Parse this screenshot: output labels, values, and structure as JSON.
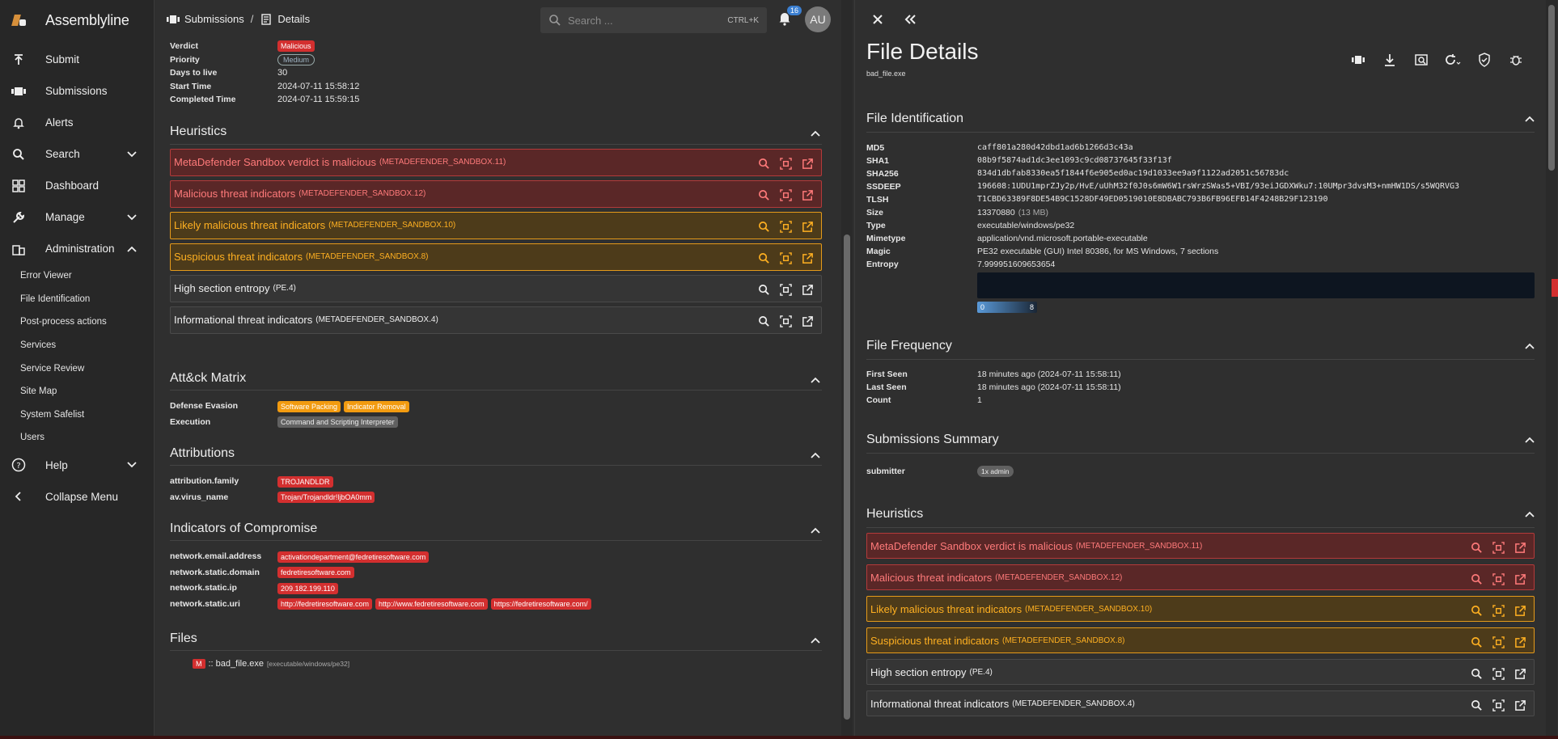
{
  "app": {
    "title": "Assemblyline"
  },
  "sidebar": {
    "items": [
      {
        "label": "Submit",
        "icon": "upload-icon"
      },
      {
        "label": "Submissions",
        "icon": "film-icon"
      },
      {
        "label": "Alerts",
        "icon": "bell-icon"
      },
      {
        "label": "Search",
        "icon": "search-icon"
      },
      {
        "label": "Dashboard",
        "icon": "dashboard-icon"
      },
      {
        "label": "Manage",
        "icon": "wrench-icon"
      },
      {
        "label": "Administration",
        "icon": "building-icon"
      }
    ],
    "admin_items": [
      "Error Viewer",
      "File Identification",
      "Post-process actions",
      "Services",
      "Service Review",
      "Site Map",
      "System Safelist",
      "Users"
    ],
    "help": "Help",
    "collapse": "Collapse Menu"
  },
  "topbar": {
    "crumb1": "Submissions",
    "crumb2": "Details",
    "search_placeholder": "Search ...",
    "shortcut": "CTRL+K",
    "notif_count": "16",
    "avatar": "AU"
  },
  "summary": {
    "verdict_label": "Verdict",
    "verdict": "Malicious",
    "priority_label": "Priority",
    "priority": "Medium",
    "ttl_label": "Days to live",
    "ttl": "30",
    "start_label": "Start Time",
    "start": "2024-07-11 15:58:12",
    "completed_label": "Completed Time",
    "completed": "2024-07-11 15:59:15"
  },
  "sections": {
    "heuristics": "Heuristics",
    "attack": "Att&ck Matrix",
    "attributions": "Attributions",
    "ioc": "Indicators of Compromise",
    "files": "Files"
  },
  "heuristics": [
    {
      "name": "MetaDefender Sandbox verdict is malicious",
      "id": "(METADEFENDER_SANDBOX.11)",
      "level": "mal"
    },
    {
      "name": "Malicious threat indicators",
      "id": "(METADEFENDER_SANDBOX.12)",
      "level": "mal"
    },
    {
      "name": "Likely malicious threat indicators",
      "id": "(METADEFENDER_SANDBOX.10)",
      "level": "sus"
    },
    {
      "name": "Suspicious threat indicators",
      "id": "(METADEFENDER_SANDBOX.8)",
      "level": "sus"
    },
    {
      "name": "High section entropy",
      "id": "(PE.4)",
      "level": "inf"
    },
    {
      "name": "Informational threat indicators",
      "id": "(METADEFENDER_SANDBOX.4)",
      "level": "inf"
    }
  ],
  "attack": {
    "defense_label": "Defense Evasion",
    "defense": [
      "Software Packing",
      "Indicator Removal"
    ],
    "exec_label": "Execution",
    "exec": [
      "Command and Scripting Interpreter"
    ]
  },
  "attributions": {
    "family_label": "attribution.family",
    "family": "TROJANDLDR",
    "virus_label": "av.virus_name",
    "virus": "Trojan/Trojandldr!ljbOA0mm"
  },
  "ioc": {
    "email_label": "network.email.address",
    "email": "activationdepartment@fedretiresoftware.com",
    "domain_label": "network.static.domain",
    "domain": "fedretiresoftware.com",
    "ip_label": "network.static.ip",
    "ip": "209.182.199.110",
    "uri_label": "network.static.uri",
    "uris": [
      "http://fedretiresoftware.com",
      "http://www.fedretiresoftware.com",
      "https://fedretiresoftware.com/"
    ]
  },
  "files": {
    "badge": "M",
    "name": ":: bad_file.exe",
    "type": "[executable/windows/pe32]"
  },
  "drawer": {
    "title": "File Details",
    "filename": "bad_file.exe",
    "ident_title": "File Identification",
    "ident": [
      {
        "k": "MD5",
        "v": "caff801a280d42dbd1ad6b1266d3c43a",
        "mono": true
      },
      {
        "k": "SHA1",
        "v": "08b9f5874ad1dc3ee1093c9cd08737645f33f13f",
        "mono": true
      },
      {
        "k": "SHA256",
        "v": "834d1dbfab8330ea5f1844f6e905ed0ac19d1033ee9a9f1122ad2051c56783dc",
        "mono": true
      },
      {
        "k": "SSDEEP",
        "v": "196608:1UDU1mprZJy2p/HvE/uUhM32f0J0s6mW6W1rsWrzSWas5+VBI/93eiJGDXWku7:10UMpr3dvsM3+nmHW1DS/s5WQRVG3",
        "mono": true
      },
      {
        "k": "TLSH",
        "v": "T1CBD63389F8DE54B9C1528DF49ED0519010E8DBABC793B6FB96EFB14F4248B29F123190",
        "mono": true
      },
      {
        "k": "Size",
        "v": "13370880",
        "extra": "(13 MB)"
      },
      {
        "k": "Type",
        "v": "executable/windows/pe32"
      },
      {
        "k": "Mimetype",
        "v": "application/vnd.microsoft.portable-executable"
      },
      {
        "k": "Magic",
        "v": "PE32 executable (GUI) Intel 80386, for MS Windows, 7 sections"
      },
      {
        "k": "Entropy",
        "v": "7.999951609653654"
      }
    ],
    "entropy_min": "0",
    "entropy_max": "8",
    "freq_title": "File Frequency",
    "freq": [
      {
        "k": "First Seen",
        "v": "18 minutes ago (2024-07-11 15:58:11)"
      },
      {
        "k": "Last Seen",
        "v": "18 minutes ago (2024-07-11 15:58:11)"
      },
      {
        "k": "Count",
        "v": "1"
      }
    ],
    "subs_title": "Submissions Summary",
    "submitter_label": "submitter",
    "submitter": "1x admin",
    "heur_title": "Heuristics"
  }
}
